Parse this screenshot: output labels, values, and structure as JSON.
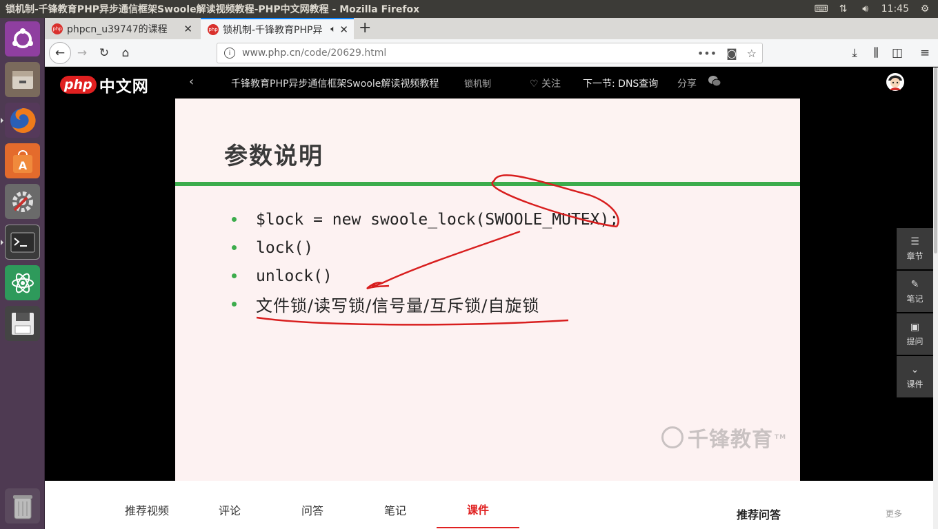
{
  "window": {
    "title": "锁机制-千锋教育PHP异步通信框架Swoole解读视频教程-PHP中文网教程 - Mozilla Firefox",
    "clock": "11:45"
  },
  "tabs": [
    {
      "label": "phpcn_u39747的课程",
      "favicon": "php"
    },
    {
      "label": "锁机制-千锋教育PHP异",
      "favicon": "php"
    }
  ],
  "urlbar": {
    "host": "www.php.cn",
    "path": "/code/20629.html"
  },
  "site": {
    "logo_php": "php",
    "logo_cn": "中文网",
    "course_title": "千锋教育PHP异步通信框架Swoole解读视频教程",
    "lesson": "锁机制",
    "follow": "关注",
    "next": "下一节: DNS查询",
    "share": "分享"
  },
  "slide": {
    "heading": "参数说明",
    "bullets": [
      "$lock = new swoole_lock(SWOOLE_MUTEX);",
      "lock()",
      "unlock()",
      "文件锁/读写锁/信号量/互斥锁/自旋锁"
    ],
    "watermark": "千锋教育",
    "watermark_tm": "TM"
  },
  "sidetools": [
    "章节",
    "笔记",
    "提问",
    "课件"
  ],
  "bottom_tabs": [
    "推荐视频",
    "评论",
    "问答",
    "笔记",
    "课件"
  ],
  "bottom_active": "课件",
  "recommend": "推荐问答",
  "more": "更多",
  "colors": {
    "accent": "#e02020",
    "slide_rule": "#3cac4c",
    "launcher": "#4e3a52"
  }
}
